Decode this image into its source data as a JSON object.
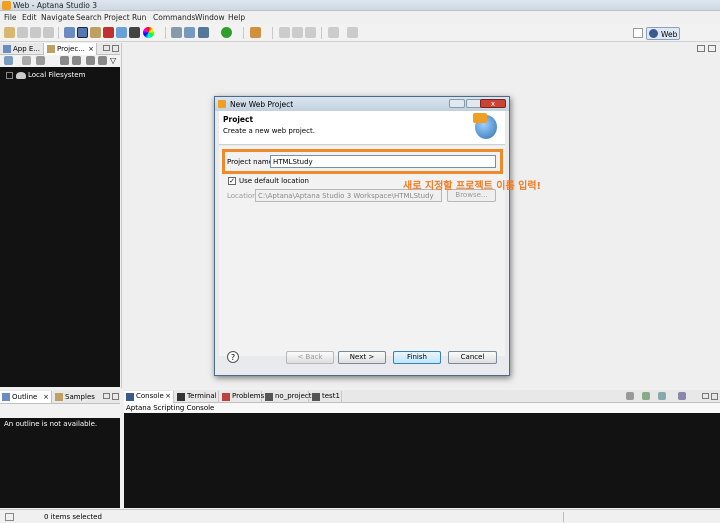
{
  "window": {
    "title": "Web - Aptana Studio 3"
  },
  "menu": [
    "File",
    "Edit",
    "Navigate",
    "Search",
    "Project",
    "Run",
    "Commands",
    "Window",
    "Help"
  ],
  "perspective": {
    "label": "Web"
  },
  "left_panel": {
    "tabs": [
      "App E...",
      "Projec..."
    ],
    "tree": [
      {
        "label": "Local Filesystem"
      }
    ]
  },
  "dialog": {
    "title": "New Web Project",
    "banner_title": "Project",
    "banner_desc": "Create a new web project.",
    "project_name_label": "Project name:",
    "project_name_value": "HTMLStudy",
    "use_default_label": "Use default location",
    "use_default_checked": "✓",
    "location_label": "Location:",
    "location_value": "C:\\Aptana\\Aptana Studio 3 Workspace\\HTMLStudy",
    "browse_label": "Browse...",
    "help_label": "?",
    "back_label": "< Back",
    "next_label": "Next >",
    "finish_label": "Finish",
    "cancel_label": "Cancel"
  },
  "annotation": "새로 지정할 프로젝트 이름 입력!",
  "bottom_left": {
    "tabs": [
      "Outline",
      "Samples"
    ],
    "message": "An outline is not available."
  },
  "console": {
    "tabs": [
      "Console",
      "Terminal",
      "Problems",
      "no_project",
      "test1"
    ],
    "header": "Aptana Scripting Console"
  },
  "status": {
    "text": "0 items selected"
  }
}
